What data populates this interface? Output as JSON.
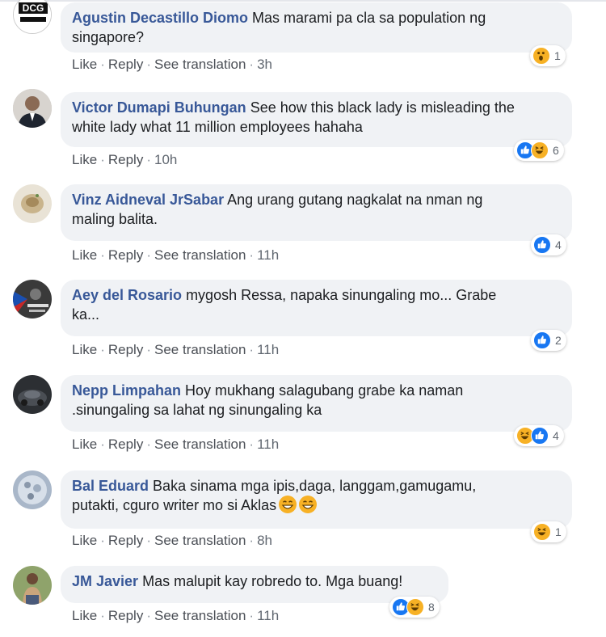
{
  "actions": {
    "like": "Like",
    "reply": "Reply",
    "see_translation": "See translation",
    "separator": "·"
  },
  "comments": [
    {
      "author": "Agustin Decastillo Diomo",
      "text_line1": "Mas marami pa cla sa population ng",
      "text_line2": "singapore?",
      "time": "3h",
      "has_translation": true,
      "reactions": [
        "wow"
      ],
      "reaction_count": "1",
      "avatar_label": "DCG"
    },
    {
      "author": "Victor Dumapi Buhungan",
      "text_line1": "See how this black lady is misleading the",
      "text_line2": "white lady what 11 million employees hahaha",
      "time": "10h",
      "has_translation": false,
      "reactions": [
        "like",
        "haha"
      ],
      "reaction_count": "6"
    },
    {
      "author": "Vinz Aidneval JrSabar",
      "text_line1": "Ang urang gutang nagkalat na nman ng",
      "text_line2": "maling balita.",
      "time": "11h",
      "has_translation": true,
      "reactions": [
        "like"
      ],
      "reaction_count": "4"
    },
    {
      "author": "Aey del Rosario",
      "text_line1": "mygosh Ressa, napaka sinungaling mo... Grabe",
      "text_line2": "ka...",
      "time": "11h",
      "has_translation": true,
      "reactions": [
        "like"
      ],
      "reaction_count": "2"
    },
    {
      "author": "Nepp Limpahan",
      "text_line1": "Hoy mukhang salagubang grabe ka naman",
      "text_line2": ".sinungaling sa lahat ng sinungaling ka",
      "time": "11h",
      "has_translation": true,
      "reactions": [
        "haha",
        "like"
      ],
      "reaction_count": "4"
    },
    {
      "author": "Bal Eduard",
      "text_line1": "Baka sinama mga ipis,daga, langgam,gamugamu,",
      "text_line2": "putakti, cguro writer mo si Aklas",
      "time": "8h",
      "has_translation": true,
      "reactions": [
        "haha"
      ],
      "reaction_count": "1"
    },
    {
      "author": "JM Javier",
      "text_line1": "Mas malupit kay robredo to. Mga buang!",
      "text_line2": "",
      "time": "11h",
      "has_translation": true,
      "reactions": [
        "like",
        "haha"
      ],
      "reaction_count": "8"
    }
  ],
  "colors": {
    "author": "#385898",
    "bubble": "#f0f2f5",
    "like": "#1877f2",
    "haha": "#f7b125"
  }
}
